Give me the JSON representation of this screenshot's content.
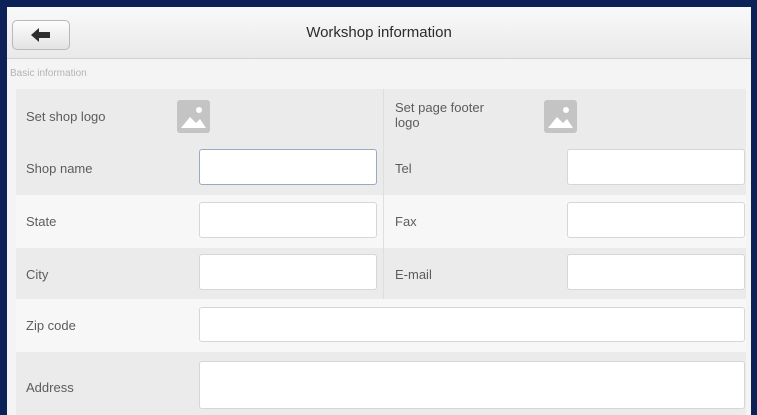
{
  "header": {
    "title": "Workshop information",
    "back_icon": "back-arrow-icon"
  },
  "section": {
    "label": "Basic information"
  },
  "logos": {
    "shop_logo_label": "Set shop logo",
    "footer_logo_label_line1": "Set page footer",
    "footer_logo_label_line2": "logo",
    "image_icon": "image-placeholder-icon"
  },
  "fields": {
    "shop_name": {
      "label": "Shop name",
      "value": ""
    },
    "tel": {
      "label": "Tel",
      "value": ""
    },
    "state": {
      "label": "State",
      "value": ""
    },
    "fax": {
      "label": "Fax",
      "value": ""
    },
    "city": {
      "label": "City",
      "value": ""
    },
    "email": {
      "label": "E-mail",
      "value": ""
    },
    "zip_code": {
      "label": "Zip code",
      "value": ""
    },
    "address": {
      "label": "Address",
      "value": ""
    }
  },
  "colors": {
    "frame": "#0c2158",
    "background": "#f4f4f4",
    "icon_gray": "#c4c4c4"
  }
}
